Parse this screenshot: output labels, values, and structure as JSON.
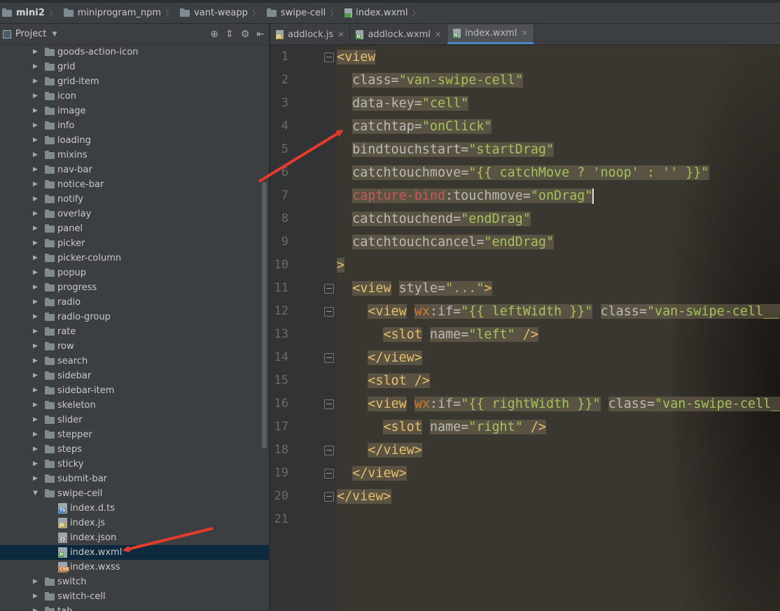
{
  "breadcrumb": [
    "mini2",
    "miniprogram_npm",
    "vant-weapp",
    "swipe-cell",
    "index.wxml"
  ],
  "project_panel": {
    "title": "Project",
    "tree": [
      {
        "label": "goods-action-icon",
        "kind": "folder"
      },
      {
        "label": "grid",
        "kind": "folder"
      },
      {
        "label": "grid-item",
        "kind": "folder"
      },
      {
        "label": "icon",
        "kind": "folder"
      },
      {
        "label": "image",
        "kind": "folder"
      },
      {
        "label": "info",
        "kind": "folder"
      },
      {
        "label": "loading",
        "kind": "folder"
      },
      {
        "label": "mixins",
        "kind": "folder"
      },
      {
        "label": "nav-bar",
        "kind": "folder"
      },
      {
        "label": "notice-bar",
        "kind": "folder"
      },
      {
        "label": "notify",
        "kind": "folder"
      },
      {
        "label": "overlay",
        "kind": "folder"
      },
      {
        "label": "panel",
        "kind": "folder"
      },
      {
        "label": "picker",
        "kind": "folder"
      },
      {
        "label": "picker-column",
        "kind": "folder"
      },
      {
        "label": "popup",
        "kind": "folder"
      },
      {
        "label": "progress",
        "kind": "folder"
      },
      {
        "label": "radio",
        "kind": "folder"
      },
      {
        "label": "radio-group",
        "kind": "folder"
      },
      {
        "label": "rate",
        "kind": "folder"
      },
      {
        "label": "row",
        "kind": "folder"
      },
      {
        "label": "search",
        "kind": "folder"
      },
      {
        "label": "sidebar",
        "kind": "folder"
      },
      {
        "label": "sidebar-item",
        "kind": "folder"
      },
      {
        "label": "skeleton",
        "kind": "folder"
      },
      {
        "label": "slider",
        "kind": "folder"
      },
      {
        "label": "stepper",
        "kind": "folder"
      },
      {
        "label": "steps",
        "kind": "folder"
      },
      {
        "label": "sticky",
        "kind": "folder"
      },
      {
        "label": "submit-bar",
        "kind": "folder"
      },
      {
        "label": "swipe-cell",
        "kind": "folder-open"
      },
      {
        "label": "index.d.ts",
        "kind": "file",
        "tag": "TS",
        "color": "#3d7ab8"
      },
      {
        "label": "index.js",
        "kind": "file",
        "tag": "JS",
        "color": "#c2a33a"
      },
      {
        "label": "index.json",
        "kind": "file",
        "tag": "{}",
        "color": "#8a8a8a"
      },
      {
        "label": "index.wxml",
        "kind": "file",
        "tag": "H",
        "color": "#4f9a4a",
        "selected": true
      },
      {
        "label": "index.wxss",
        "kind": "file",
        "tag": "CSS",
        "color": "#c26a2a"
      },
      {
        "label": "switch",
        "kind": "folder"
      },
      {
        "label": "switch-cell",
        "kind": "folder"
      },
      {
        "label": "tab",
        "kind": "folder"
      }
    ]
  },
  "tabs": [
    {
      "label": "addlock.js",
      "tag": "JS",
      "color": "#c2a33a",
      "active": false
    },
    {
      "label": "addlock.wxml",
      "tag": "H",
      "color": "#4f9a4a",
      "active": false
    },
    {
      "label": "index.wxml",
      "tag": "H",
      "color": "#4f9a4a",
      "active": true
    }
  ],
  "line_numbers": [
    "1",
    "2",
    "3",
    "4",
    "5",
    "6",
    "7",
    "8",
    "9",
    "10",
    "11",
    "12",
    "13",
    "14",
    "15",
    "16",
    "17",
    "18",
    "19",
    "20",
    "21"
  ],
  "code_lines": [
    [
      {
        "t": "<view",
        "c": "tg"
      }
    ],
    [
      {
        "t": "  "
      },
      {
        "t": "class",
        "c": "at"
      },
      {
        "t": "=",
        "c": "at"
      },
      {
        "t": "\"van-swipe-cell\"",
        "c": "st"
      }
    ],
    [
      {
        "t": "  "
      },
      {
        "t": "data-key",
        "c": "at"
      },
      {
        "t": "=",
        "c": "at"
      },
      {
        "t": "\"cell\"",
        "c": "st"
      }
    ],
    [
      {
        "t": "  "
      },
      {
        "t": "catchtap",
        "c": "at"
      },
      {
        "t": "=",
        "c": "at"
      },
      {
        "t": "\"onClick\"",
        "c": "st"
      }
    ],
    [
      {
        "t": "  "
      },
      {
        "t": "bindtouchstart",
        "c": "at"
      },
      {
        "t": "=",
        "c": "at"
      },
      {
        "t": "\"startDrag\"",
        "c": "st"
      }
    ],
    [
      {
        "t": "  "
      },
      {
        "t": "catchtouchmove",
        "c": "at"
      },
      {
        "t": "=",
        "c": "at"
      },
      {
        "t": "\"{{ catchMove ? 'noop' : '' }}\"",
        "c": "st"
      }
    ],
    [
      {
        "t": "  "
      },
      {
        "t": "capture-bind",
        "c": "wr"
      },
      {
        "t": ":touchmove",
        "c": "at"
      },
      {
        "t": "=",
        "c": "at"
      },
      {
        "t": "\"onDrag\"",
        "c": "st"
      }
    ],
    [
      {
        "t": "  "
      },
      {
        "t": "catchtouchend",
        "c": "at"
      },
      {
        "t": "=",
        "c": "at"
      },
      {
        "t": "\"endDrag\"",
        "c": "st"
      }
    ],
    [
      {
        "t": "  "
      },
      {
        "t": "catchtouchcancel",
        "c": "at"
      },
      {
        "t": "=",
        "c": "at"
      },
      {
        "t": "\"endDrag\"",
        "c": "st"
      }
    ],
    [
      {
        "t": ">",
        "c": "tg"
      }
    ],
    [
      {
        "t": "  "
      },
      {
        "t": "<view",
        "c": "tg"
      },
      {
        "t": " "
      },
      {
        "t": "style",
        "c": "at"
      },
      {
        "t": "=",
        "c": "at"
      },
      {
        "t": "\"...\"",
        "c": "st"
      },
      {
        "t": ">",
        "c": "tg"
      }
    ],
    [
      {
        "t": "    "
      },
      {
        "t": "<view",
        "c": "tg"
      },
      {
        "t": " "
      },
      {
        "t": "wx",
        "c": "ns"
      },
      {
        "t": ":if",
        "c": "at"
      },
      {
        "t": "=",
        "c": "at"
      },
      {
        "t": "\"{{ leftWidth }}\"",
        "c": "st"
      },
      {
        "t": " "
      },
      {
        "t": "class",
        "c": "at"
      },
      {
        "t": "=",
        "c": "at"
      },
      {
        "t": "\"van-swipe-cell__l",
        "c": "st"
      }
    ],
    [
      {
        "t": "      "
      },
      {
        "t": "<slot",
        "c": "tg"
      },
      {
        "t": " "
      },
      {
        "t": "name",
        "c": "at"
      },
      {
        "t": "=",
        "c": "at"
      },
      {
        "t": "\"left\"",
        "c": "st"
      },
      {
        "t": " />",
        "c": "tg"
      }
    ],
    [
      {
        "t": "    "
      },
      {
        "t": "</view>",
        "c": "tg"
      }
    ],
    [
      {
        "t": "    "
      },
      {
        "t": "<slot />",
        "c": "tg"
      }
    ],
    [
      {
        "t": "    "
      },
      {
        "t": "<view",
        "c": "tg"
      },
      {
        "t": " "
      },
      {
        "t": "wx",
        "c": "ns"
      },
      {
        "t": ":if",
        "c": "at"
      },
      {
        "t": "=",
        "c": "at"
      },
      {
        "t": "\"{{ rightWidth }}\"",
        "c": "st"
      },
      {
        "t": " "
      },
      {
        "t": "class",
        "c": "at"
      },
      {
        "t": "=",
        "c": "at"
      },
      {
        "t": "\"van-swipe-cell__",
        "c": "st"
      }
    ],
    [
      {
        "t": "      "
      },
      {
        "t": "<slot",
        "c": "tg"
      },
      {
        "t": " "
      },
      {
        "t": "name",
        "c": "at"
      },
      {
        "t": "=",
        "c": "at"
      },
      {
        "t": "\"right\"",
        "c": "st"
      },
      {
        "t": " />",
        "c": "tg"
      }
    ],
    [
      {
        "t": "    "
      },
      {
        "t": "</view>",
        "c": "tg"
      }
    ],
    [
      {
        "t": "  "
      },
      {
        "t": "</view>",
        "c": "tg"
      }
    ],
    [
      {
        "t": "</view>",
        "c": "tg"
      }
    ],
    []
  ]
}
